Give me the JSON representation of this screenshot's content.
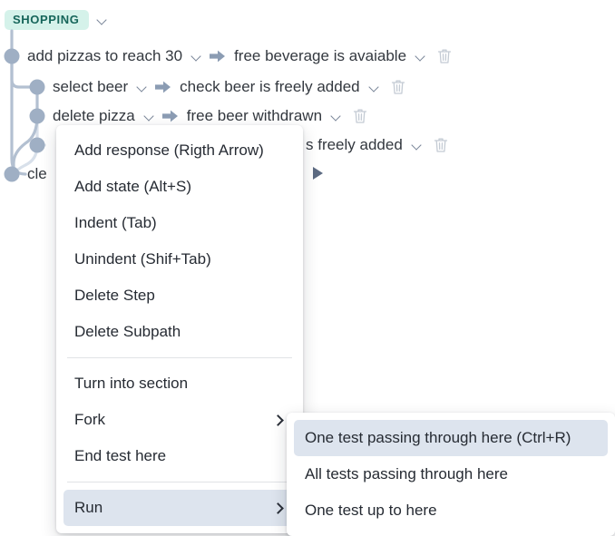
{
  "section": {
    "badge_label": "SHOPPING",
    "badge_bg": "#d5f2ea",
    "badge_color": "#16655a",
    "collapse_icon": "chevron-down-icon"
  },
  "steps": [
    {
      "action": "add pizzas to reach 30",
      "response": "free beverage is avaiable",
      "has_delete": true,
      "level": 0
    },
    {
      "action": "select beer",
      "response": "check beer is freely added",
      "has_delete": true,
      "level": 1
    },
    {
      "action": "delete pizza",
      "response": "free beer withdrawn",
      "has_delete": true,
      "level": 1
    },
    {
      "action": "",
      "response": "s freely added",
      "has_delete": true,
      "level": 1
    },
    {
      "action": "cle",
      "response": "",
      "has_delete": false,
      "level": 0
    }
  ],
  "context_menu": {
    "items": [
      {
        "label": "Add response (Rigth Arrow)",
        "submenu": false,
        "selected": false
      },
      {
        "label": "Add state (Alt+S)",
        "submenu": false,
        "selected": false
      },
      {
        "label": "Indent (Tab)",
        "submenu": false,
        "selected": false
      },
      {
        "label": "Unindent (Shif+Tab)",
        "submenu": false,
        "selected": false
      },
      {
        "label": "Delete Step",
        "submenu": false,
        "selected": false
      },
      {
        "label": "Delete Subpath",
        "submenu": false,
        "selected": false
      },
      {
        "label": "Turn into section",
        "submenu": false,
        "selected": false
      },
      {
        "label": "Fork",
        "submenu": true,
        "selected": false
      },
      {
        "label": "End test here",
        "submenu": false,
        "selected": false
      },
      {
        "label": "Run",
        "submenu": true,
        "selected": true
      }
    ],
    "highlight_color": "#dde4ee"
  },
  "run_submenu": {
    "items": [
      {
        "label": "One test passing through here (Ctrl+R)",
        "selected": true
      },
      {
        "label": "All tests passing through here",
        "selected": false
      },
      {
        "label": "One test up to here",
        "selected": false
      }
    ]
  },
  "colors": {
    "node_fill": "#9fafc4",
    "line_stroke": "#b3c0d1",
    "line_stroke_light": "#d8e0ea",
    "arrow_fill": "#8b9cb3",
    "trash_stroke": "#c4cbd4",
    "play_fill": "#5c6a82"
  }
}
